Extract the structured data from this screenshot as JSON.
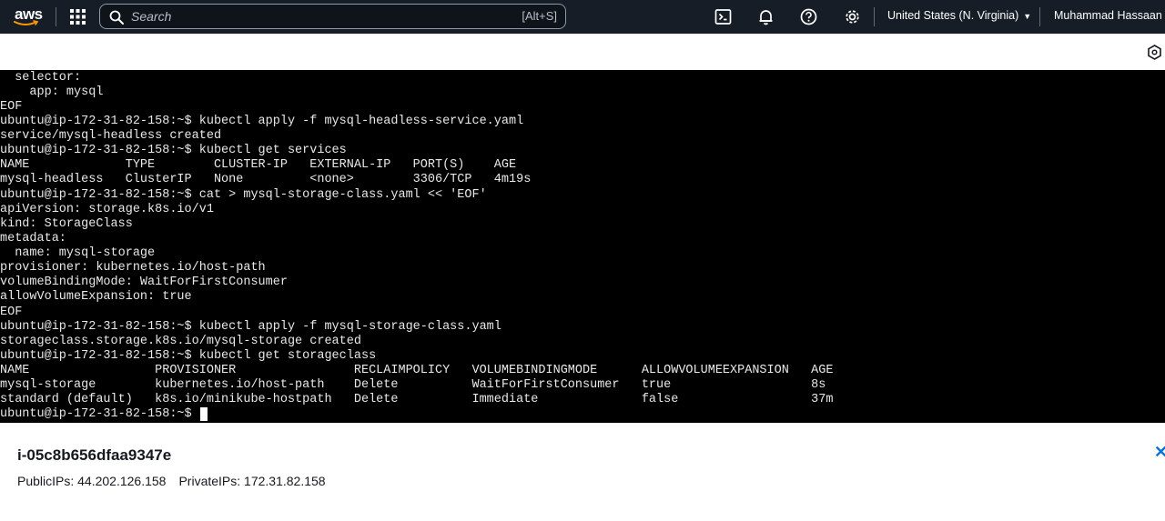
{
  "topnav": {
    "logo_text": "aws",
    "search_placeholder": "Search",
    "search_shortcut": "[Alt+S]",
    "region": "United States (N. Virginia)",
    "user": "Muhammad Hassaan",
    "icons": [
      "aws-logo",
      "apps-grid-icon",
      "search-icon",
      "cloudshell-icon",
      "bell-icon",
      "help-icon",
      "gear-icon",
      "caret-down-icon"
    ]
  },
  "terminal": {
    "lines": [
      "  selector:",
      "    app: mysql",
      "EOF",
      "ubuntu@ip-172-31-82-158:~$ kubectl apply -f mysql-headless-service.yaml",
      "service/mysql-headless created",
      "ubuntu@ip-172-31-82-158:~$ kubectl get services",
      "NAME             TYPE        CLUSTER-IP   EXTERNAL-IP   PORT(S)    AGE",
      "mysql-headless   ClusterIP   None         <none>        3306/TCP   4m19s",
      "ubuntu@ip-172-31-82-158:~$ cat > mysql-storage-class.yaml << 'EOF'",
      "apiVersion: storage.k8s.io/v1",
      "kind: StorageClass",
      "metadata:",
      "  name: mysql-storage",
      "provisioner: kubernetes.io/host-path",
      "volumeBindingMode: WaitForFirstConsumer",
      "allowVolumeExpansion: true",
      "EOF",
      "ubuntu@ip-172-31-82-158:~$ kubectl apply -f mysql-storage-class.yaml",
      "storageclass.storage.k8s.io/mysql-storage created",
      "ubuntu@ip-172-31-82-158:~$ kubectl get storageclass",
      "NAME                 PROVISIONER                RECLAIMPOLICY   VOLUMEBINDINGMODE      ALLOWVOLUMEEXPANSION   AGE",
      "mysql-storage        kubernetes.io/host-path    Delete          WaitForFirstConsumer   true                   8s",
      "standard (default)   k8s.io/minikube-hostpath   Delete          Immediate              false                  37m"
    ],
    "prompt": "ubuntu@ip-172-31-82-158:~$ "
  },
  "instance": {
    "id": "i-05c8b656dfaa9347e",
    "public_ips_label": "PublicIPs: 44.202.126.158",
    "private_ips_label": "PrivateIPs: 172.31.82.158"
  },
  "colors": {
    "nav_bg": "#161d26",
    "terminal_bg": "#000000",
    "terminal_text": "#e8e8e8",
    "link_blue": "#0972d3"
  }
}
